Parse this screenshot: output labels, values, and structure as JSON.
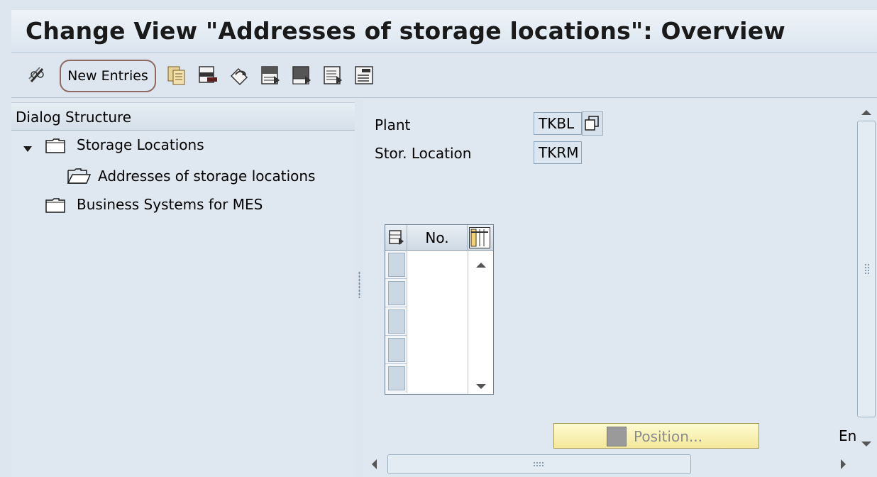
{
  "window": {
    "title": "Change View \"Addresses of storage locations\": Overview"
  },
  "toolbar": {
    "new_entries_label": "New Entries",
    "icons": [
      "pencil-glasses-icon",
      "copy-icon",
      "delete-icon",
      "undo-icon",
      "select-all-icon",
      "select-block-icon",
      "deselect-all-icon",
      "print-icon"
    ]
  },
  "dialog_structure": {
    "header": "Dialog Structure",
    "items": [
      {
        "label": "Storage Locations",
        "expanded": true,
        "level": 0
      },
      {
        "label": "Addresses of storage locations",
        "level": 1,
        "selected": true
      },
      {
        "label": "Business Systems for MES",
        "level": 0
      }
    ]
  },
  "fields": {
    "plant_label": "Plant",
    "plant_value": "TKBL",
    "stor_location_label": "Stor. Location",
    "stor_location_value": "TKRM"
  },
  "table": {
    "column_header": "No.",
    "rows": [
      "",
      "",
      "",
      "",
      ""
    ]
  },
  "footer": {
    "position_button_label": "Position...",
    "entry_text": "En"
  },
  "colors": {
    "background": "#dde6ee",
    "selected_row": "#fdf4a8",
    "button_highlight": "#8e6a63"
  }
}
